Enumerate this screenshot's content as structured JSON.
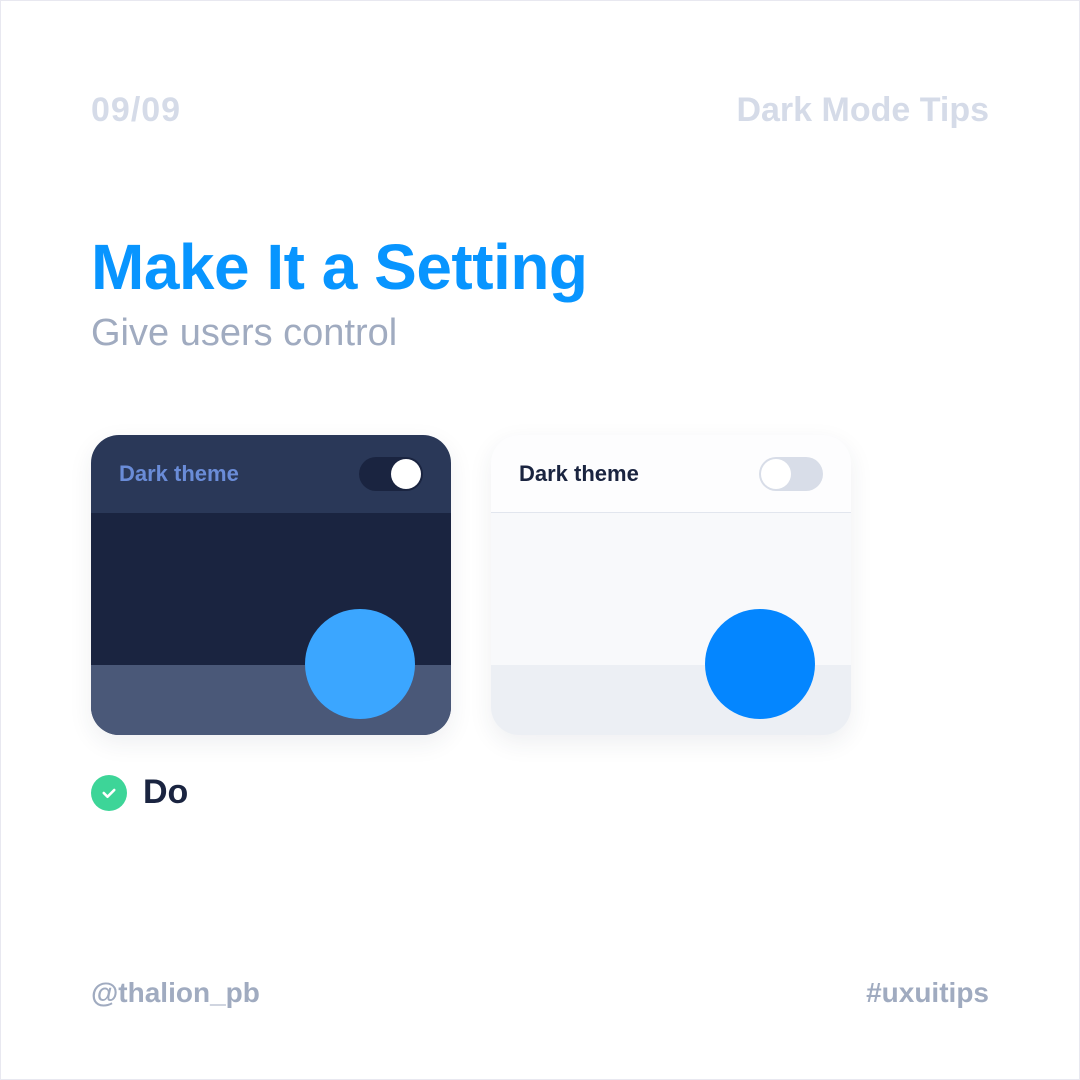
{
  "header": {
    "page_counter": "09/09",
    "series_title": "Dark Mode Tips"
  },
  "content": {
    "title": "Make It a Setting",
    "subtitle": "Give users control"
  },
  "cards": {
    "dark": {
      "toggle_label": "Dark theme",
      "toggle_state": "on"
    },
    "light": {
      "toggle_label": "Dark theme",
      "toggle_state": "off"
    }
  },
  "verdict": {
    "label": "Do",
    "icon": "check"
  },
  "footer": {
    "handle": "@thalion_pb",
    "hashtag": "#uxuitips"
  },
  "colors": {
    "accent_blue": "#0895ff",
    "success_green": "#3dd598",
    "muted_text": "#a0abc0"
  }
}
